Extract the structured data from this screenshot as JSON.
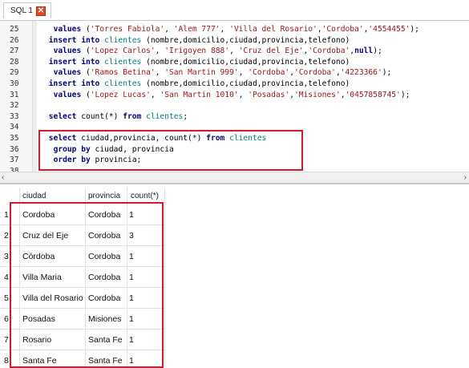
{
  "tab": {
    "label": "SQL 1",
    "close_glyph": "✕"
  },
  "editor": {
    "lines": [
      {
        "n": "25",
        "html": "  <span class=\"kw\">values</span> (<span class=\"str\">'Torres Fabiola'</span>, <span class=\"str\">'Alem 777'</span>, <span class=\"str\">'Villa del Rosario'</span>,<span class=\"str\">'Cordoba'</span>,<span class=\"str\">'4554455'</span>);"
      },
      {
        "n": "26",
        "html": " <span class=\"kw\">insert into</span> <span class=\"tb\">clientes</span> (nombre,domicilio,ciudad,provincia,telefono)"
      },
      {
        "n": "27",
        "html": "  <span class=\"kw\">values</span> (<span class=\"str\">'Lopez Carlos'</span>, <span class=\"str\">'Irigoyen 888'</span>, <span class=\"str\">'Cruz del Eje'</span>,<span class=\"str\">'Cordoba'</span>,<span class=\"kw\">null</span>);"
      },
      {
        "n": "28",
        "html": " <span class=\"kw\">insert into</span> <span class=\"tb\">clientes</span> (nombre,domicilio,ciudad,provincia,telefono)"
      },
      {
        "n": "29",
        "html": "  <span class=\"kw\">values</span> (<span class=\"str\">'Ramos Betina'</span>, <span class=\"str\">'San Martin 999'</span>, <span class=\"str\">'Cordoba'</span>,<span class=\"str\">'Cordoba'</span>,<span class=\"str\">'4223366'</span>);"
      },
      {
        "n": "30",
        "html": " <span class=\"kw\">insert into</span> <span class=\"tb\">clientes</span> (nombre,domicilio,ciudad,provincia,telefono)"
      },
      {
        "n": "31",
        "html": "  <span class=\"kw\">values</span> (<span class=\"str\">'Lopez Lucas'</span>, <span class=\"str\">'San Martin 1010'</span>, <span class=\"str\">'Posadas'</span>,<span class=\"str\">'Misiones'</span>,<span class=\"str\">'0457858745'</span>);"
      },
      {
        "n": "32",
        "html": ""
      },
      {
        "n": "33",
        "html": " <span class=\"kw\">select</span> count(*) <span class=\"kw\">from</span> <span class=\"tb\">clientes</span>;"
      },
      {
        "n": "34",
        "html": ""
      },
      {
        "n": "35",
        "html": " <span class=\"kw\">select</span> ciudad,provincia, count(*) <span class=\"kw\">from</span> <span class=\"tb\">clientes</span>"
      },
      {
        "n": "36",
        "html": "  <span class=\"kw\">group by</span> ciudad, provincia"
      },
      {
        "n": "37",
        "html": "  <span class=\"kw\">order by</span> provincia;"
      },
      {
        "n": "38",
        "html": ""
      }
    ]
  },
  "results": {
    "columns": [
      "ciudad",
      "provincia",
      "count(*)"
    ],
    "rows": [
      {
        "idx": "1",
        "ciudad": "Cordoba",
        "provincia": "Cordoba",
        "count": "1"
      },
      {
        "idx": "2",
        "ciudad": "Cruz del Eje",
        "provincia": "Cordoba",
        "count": "3"
      },
      {
        "idx": "3",
        "ciudad": "Córdoba",
        "provincia": "Cordoba",
        "count": "1"
      },
      {
        "idx": "4",
        "ciudad": "Villa Maria",
        "provincia": "Cordoba",
        "count": "1"
      },
      {
        "idx": "5",
        "ciudad": "Villa del Rosario",
        "provincia": "Cordoba",
        "count": "1"
      },
      {
        "idx": "6",
        "ciudad": "Posadas",
        "provincia": "Misiones",
        "count": "1"
      },
      {
        "idx": "7",
        "ciudad": "Rosario",
        "provincia": "Santa Fe",
        "count": "1"
      },
      {
        "idx": "8",
        "ciudad": "Santa Fe",
        "provincia": "Santa Fe",
        "count": "1"
      }
    ]
  },
  "scroll": {
    "left_glyph": "‹",
    "right_glyph": "›"
  },
  "colors": {
    "highlight": "#d9182d",
    "keyword": "#00008b",
    "table": "#008080",
    "string": "#a31515"
  }
}
